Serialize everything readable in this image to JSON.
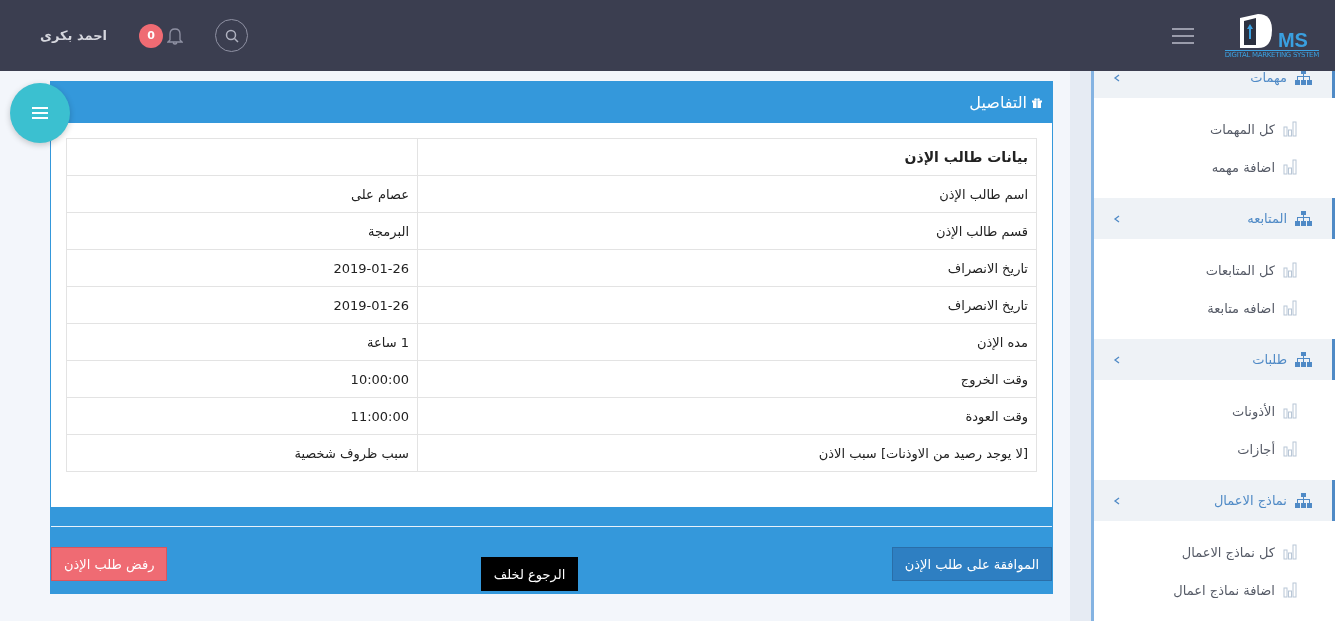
{
  "header": {
    "logo": {
      "mark": "MS",
      "tagline": "DIGITAL MARKETING SYSTEM"
    },
    "notifications": {
      "count": "0"
    },
    "user": {
      "name": "احمد بكرى"
    }
  },
  "sidebar": {
    "sections": [
      {
        "title": "مهمات",
        "expanded": true,
        "items": [
          "كل المهمات",
          "اضافة مهمه"
        ]
      },
      {
        "title": "المتابعه",
        "expanded": true,
        "items": [
          "كل المتابعات",
          "اضافه متابعة"
        ]
      },
      {
        "title": "طلبات",
        "expanded": true,
        "items": [
          "الأذونات",
          "أجازات"
        ]
      },
      {
        "title": "نماذج الاعمال",
        "expanded": true,
        "items": [
          "كل نماذج الاعمال",
          "اضافة نماذج اعمال"
        ]
      }
    ]
  },
  "panel": {
    "title": "التفاصيل",
    "table": {
      "heading": "بيانات طالب الإذن",
      "rows": [
        {
          "label": "اسم طالب الإذن",
          "value": "عصام على"
        },
        {
          "label": "قسم طالب الإذن",
          "value": "البرمجة"
        },
        {
          "label": "تاريخ الانصراف",
          "value": "2019-01-26"
        },
        {
          "label": "تاريخ الانصراف",
          "value": "2019-01-26"
        },
        {
          "label": "مده الإذن",
          "value": "1 ساعة"
        },
        {
          "label": "وقت الخروج",
          "value": "10:00:00"
        },
        {
          "label": "وقت العودة",
          "value": "11:00:00"
        },
        {
          "label": "[لا يوجد رصيد من الاوذنات] سبب الاذن",
          "value": "سبب ظروف شخصية"
        }
      ]
    },
    "buttons": [
      {
        "kind": "approve",
        "label": "الموافقة على طلب الإذن"
      },
      {
        "kind": "back",
        "label": "الرجوع لخلف"
      },
      {
        "kind": "reject",
        "label": "رفض طلب الإذن"
      }
    ]
  }
}
